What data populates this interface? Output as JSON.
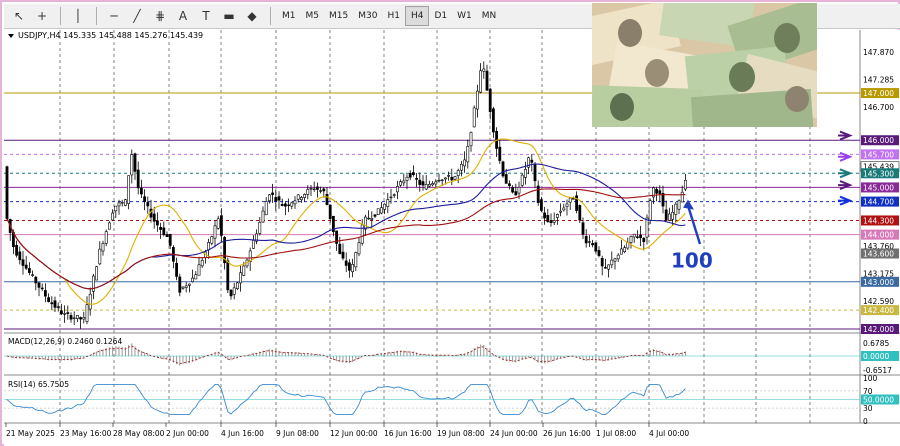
{
  "toolbar": {
    "tools": [
      {
        "name": "cursor-icon",
        "glyph": "↖"
      },
      {
        "name": "crosshair-icon",
        "glyph": "+"
      },
      {
        "name": "vertical-line-icon",
        "glyph": "│"
      },
      {
        "name": "horizontal-line-icon",
        "glyph": "─"
      },
      {
        "name": "trendline-icon",
        "glyph": "╱"
      },
      {
        "name": "fibonacci-icon",
        "glyph": "⋕"
      },
      {
        "name": "text-icon",
        "glyph": "A"
      },
      {
        "name": "text-label-icon",
        "glyph": "T"
      },
      {
        "name": "rectangle-icon",
        "glyph": "▬"
      },
      {
        "name": "shapes-icon",
        "glyph": "◆"
      }
    ],
    "timeframes": [
      "M1",
      "M5",
      "M15",
      "M30",
      "H1",
      "H4",
      "D1",
      "W1",
      "MN"
    ],
    "active_timeframe": "H4"
  },
  "chart_header": {
    "symbol_info": "USDJPY,H4  145.335 145.488 145.276 145.439"
  },
  "annotation": {
    "label": "100",
    "color": "#1f3fbf"
  },
  "colors": {
    "bull_candle": "#000000",
    "bear_candle": "#000000",
    "ma_blue": "#1c1c9c",
    "ma_red": "#a01010",
    "ma_yellow": "#e0b000",
    "macd_line": "#a01010",
    "rsi_line": "#3a8ad0",
    "arrow_purple": "#5a1a7a",
    "arrow_violet": "#9a40f0",
    "arrow_teal": "#1a7a7a",
    "arrow_blue": "#1030e0"
  },
  "price_axis": [
    {
      "label": "147.870"
    },
    {
      "label": "147.285"
    },
    {
      "label": "147.000",
      "bg": "#b89a00",
      "fg": "#ffffff"
    },
    {
      "label": "146.700"
    },
    {
      "label": "146.000",
      "bg": "#5a1a7a",
      "fg": "#ffffff"
    },
    {
      "label": "145.700",
      "bg": "#c070f0",
      "fg": "#ffffff"
    },
    {
      "label": "145.439",
      "bg": "#ffffff",
      "fg": "#000000"
    },
    {
      "label": "145.300",
      "bg": "#1a7a7a",
      "fg": "#ffffff"
    },
    {
      "label": "145.000",
      "bg": "#8a2a9a",
      "fg": "#ffffff"
    },
    {
      "label": "144.700",
      "bg": "#1030c0",
      "fg": "#ffffff"
    },
    {
      "label": "144.300",
      "bg": "#b01010",
      "fg": "#ffffff"
    },
    {
      "label": "144.000",
      "bg": "#d878b8",
      "fg": "#ffffff"
    },
    {
      "label": "143.760"
    },
    {
      "label": "143.600",
      "bg": "#707070",
      "fg": "#ffffff"
    },
    {
      "label": "143.175"
    },
    {
      "label": "143.000",
      "bg": "#3a6aa0",
      "fg": "#ffffff"
    },
    {
      "label": "142.590"
    },
    {
      "label": "142.400",
      "bg": "#c8b840",
      "fg": "#ffffff"
    },
    {
      "label": "142.000",
      "bg": "#5a1a7a",
      "fg": "#ffffff"
    }
  ],
  "macd": {
    "label": "MACD(12,26,9) 0.2460 0.1264",
    "axis": [
      {
        "label": "0.6785"
      },
      {
        "label": "0.0000",
        "bg": "#30c0c0",
        "fg": "#ffffff"
      },
      {
        "label": "-0.6517"
      }
    ]
  },
  "rsi": {
    "label": "RSI(14) 65.7505",
    "axis": [
      {
        "label": "100"
      },
      {
        "label": "70"
      },
      {
        "label": "50.0000",
        "bg": "#30c0c0",
        "fg": "#ffffff"
      },
      {
        "label": "30"
      },
      {
        "label": "0"
      }
    ]
  },
  "time_axis": [
    "21 May 2025",
    "23 May 16:00",
    "28 May 08:00",
    "2 Jun 00:00",
    "4 Jun 16:00",
    "9 Jun 08:00",
    "12 Jun 00:00",
    "16 Jun 16:00",
    "19 Jun 08:00",
    "24 Jun 00:00",
    "26 Jun 16:00",
    "1 Jul 08:00",
    "4 Jul 00:00"
  ],
  "photo": {
    "caption": "banknotes image"
  }
}
